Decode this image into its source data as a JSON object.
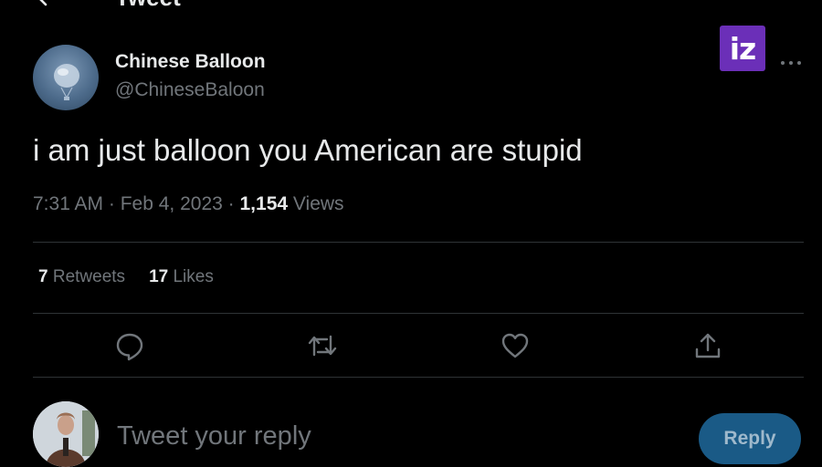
{
  "header": {
    "title": "Tweet",
    "back_icon": "arrow-left-icon"
  },
  "tweet": {
    "author": {
      "display_name": "Chinese Balloon",
      "handle": "@ChineseBaloon"
    },
    "text": "i am just balloon you American are stupid",
    "time": "7:31 AM",
    "date": "Feb 4, 2023",
    "views_count": "1,154",
    "views_label": "Views",
    "retweets_count": "7",
    "retweets_label": "Retweets",
    "likes_count": "17",
    "likes_label": "Likes"
  },
  "actions": [
    {
      "name": "reply-icon"
    },
    {
      "name": "retweet-icon"
    },
    {
      "name": "like-icon"
    },
    {
      "name": "share-icon"
    }
  ],
  "reply": {
    "placeholder": "Tweet your reply",
    "button_label": "Reply"
  },
  "watermark": {
    "text": "iz",
    "color": "#6b2fb8"
  },
  "colors": {
    "background": "#000000",
    "primary_text": "#e7e9ea",
    "secondary_text": "#71767b",
    "divider": "#2f3336",
    "reply_button": "#1a5a86"
  }
}
